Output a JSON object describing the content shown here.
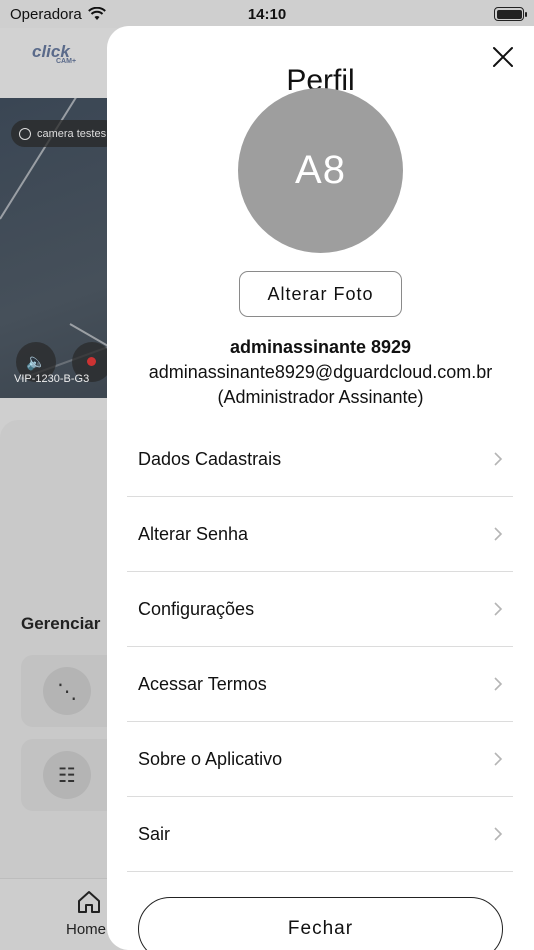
{
  "status_bar": {
    "carrier": "Operadora",
    "time": "14:10"
  },
  "background": {
    "logo": "click",
    "logo_sub": "CAM+",
    "camera_chip": "camera testes",
    "camera_model": "VIP-1230-B-G3",
    "manage_title": "Gerenciar",
    "tab_home": "Home"
  },
  "profile": {
    "title": "Perfil",
    "avatar_initials": "A8",
    "change_photo_label": "Alterar Foto",
    "user_name": "adminassinante 8929",
    "user_email": "adminassinante8929@dguardcloud.com.br",
    "user_role": "(Administrador Assinante)",
    "menu": [
      {
        "label": "Dados Cadastrais"
      },
      {
        "label": "Alterar Senha"
      },
      {
        "label": "Configurações"
      },
      {
        "label": "Acessar Termos"
      },
      {
        "label": "Sobre o Aplicativo"
      },
      {
        "label": "Sair"
      }
    ],
    "close_button_label": "Fechar"
  },
  "colors": {
    "avatar_bg": "#9e9e9e",
    "sheet_bg": "#ffffff",
    "overlay": "#cfcfcf"
  }
}
